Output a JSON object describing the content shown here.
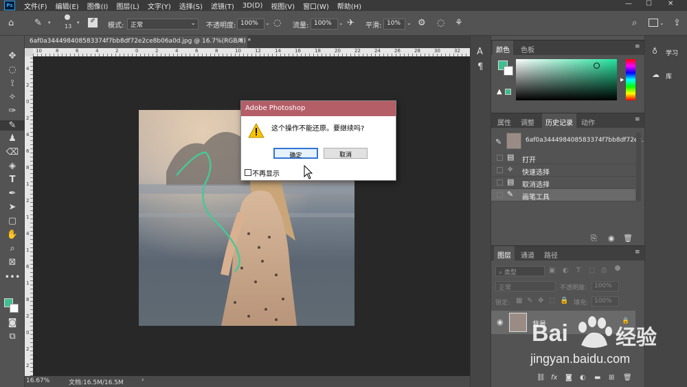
{
  "app": {
    "logo": "Ps"
  },
  "menu": [
    "文件(F)",
    "编辑(E)",
    "图像(I)",
    "图层(L)",
    "文字(Y)",
    "选择(S)",
    "滤镜(T)",
    "3D(D)",
    "视图(V)",
    "窗口(W)",
    "帮助(H)"
  ],
  "window_controls": {
    "minimize": "—",
    "maximize": "☐",
    "close": "✕"
  },
  "options": {
    "brush_size": "13",
    "mode_label": "模式:",
    "mode_value": "正常",
    "opacity_label": "不透明度:",
    "opacity_value": "100%",
    "flow_label": "流量:",
    "flow_value": "100%",
    "smooth_label": "平滑:",
    "smooth_value": "10%"
  },
  "document": {
    "tab_title": "6af0a344498408583374f7bb8df72e2ce8b06a0d.jpg @ 16.7%(RGB/8) *",
    "close": "×",
    "ruler_h": [
      "10",
      "8",
      "6",
      "4",
      "2",
      "0",
      "2",
      "4",
      "6",
      "8",
      "10",
      "12",
      "14",
      "16",
      "18",
      "20",
      "22",
      "24",
      "26",
      "28",
      "30",
      "32"
    ],
    "ruler_v": [
      "4",
      "2",
      "0",
      "2",
      "4",
      "6",
      "8",
      "1",
      "2",
      "1",
      "4",
      "1",
      "6",
      "1",
      "8",
      "2",
      "0",
      "2",
      "2"
    ]
  },
  "status": {
    "zoom": "16.67%",
    "doc_info": "文档:16.5M/16.5M",
    "arrow": "›"
  },
  "dialog": {
    "title": "Adobe Photoshop",
    "message": "这个操作不能还原。要继续吗?",
    "ok": "确定",
    "cancel": "取消",
    "dont_show": "不再显示"
  },
  "color_panel": {
    "tabs": [
      "颜色",
      "色板"
    ],
    "foreground": "#3fbf8f",
    "background": "#ffffff",
    "hue_color": "#24e3a0"
  },
  "history_panel": {
    "tabs": [
      "属性",
      "调整",
      "历史记录",
      "动作"
    ],
    "snapshot": "6af0a344498408583374f7bb8df72e2...",
    "items": [
      {
        "label": "打开",
        "icon": "document-icon"
      },
      {
        "label": "快速选择",
        "icon": "quick-select-icon"
      },
      {
        "label": "取消选择",
        "icon": "document-icon"
      },
      {
        "label": "画笔工具",
        "icon": "brush-icon"
      }
    ]
  },
  "layers_panel": {
    "tabs": [
      "图层",
      "通道",
      "路径"
    ],
    "filter_label": "类型",
    "blend": "正常",
    "opacity_label": "不透明度:",
    "opacity_value": "100%",
    "lock_label": "锁定:",
    "fill_label": "填充:",
    "fill_value": "100%",
    "layers": [
      {
        "name": "背景",
        "visible": true,
        "locked": true
      }
    ]
  },
  "right_dock": {
    "learn": "学习",
    "library": "库"
  },
  "watermark": {
    "site": "jingyan.baidu.com",
    "brand_prefix": "Bai",
    "brand_suffix": "经验"
  }
}
